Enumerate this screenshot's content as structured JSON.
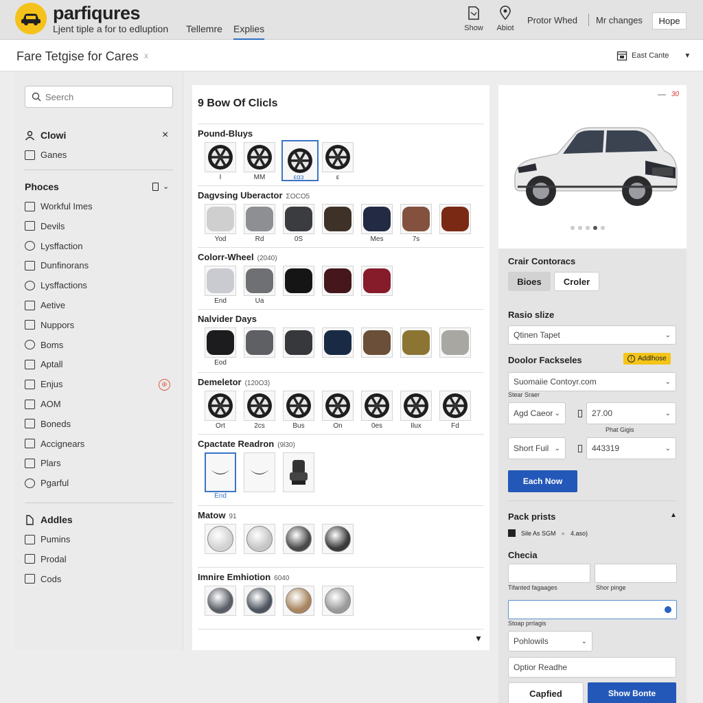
{
  "header": {
    "brand": "parfiqures",
    "tagline": "Ljent tiple a for to edluption",
    "tabs": [
      "Tellemre",
      "Explies"
    ],
    "icon_buttons": [
      {
        "icon": "document-icon",
        "label": "Show"
      },
      {
        "icon": "location-pin-icon",
        "label": "Abiot"
      }
    ],
    "links": [
      "Protor Whed",
      "Mr changes"
    ],
    "hope_label": "Hope"
  },
  "subheader": {
    "title": "Fare Tetgise for Cares",
    "close": "x",
    "sort_label": "East Cante"
  },
  "sidebar": {
    "search_placeholder": "Seerch",
    "group1": {
      "title": "Clowi",
      "close": "×",
      "items": [
        "Ganes"
      ]
    },
    "group2": {
      "title": "Phoces",
      "items": [
        "Workful Imes",
        "Devils",
        "Lysffaction",
        "Dunfinorans",
        "Lysffactions",
        "Aetive",
        "Nuppors",
        "Boms",
        "Aptall",
        "Enjus",
        "AOM",
        "Boneds",
        "Accignears",
        "Plars",
        "Pgarful"
      ]
    },
    "group3": {
      "title": "Addles",
      "items": [
        "Pumins",
        "Prodal",
        "Cods"
      ]
    }
  },
  "center": {
    "title": "9 Bow Of Clicls",
    "sections": [
      {
        "title": "Pound-Bluys",
        "hint": "",
        "kind": "wheel",
        "items": [
          {
            "label": "I"
          },
          {
            "label": "MM"
          },
          {
            "label": "εαз",
            "selected": true
          },
          {
            "label": "ε"
          }
        ]
      },
      {
        "title": "Dagvsing Uberactor",
        "hint": "ΣOCO5",
        "kind": "blob",
        "items": [
          {
            "label": "Yod",
            "color": "#cfcfcf"
          },
          {
            "label": "Rd",
            "color": "#8d8f93"
          },
          {
            "label": "0S",
            "color": "#3b3c40"
          },
          {
            "label": "",
            "color": "#3e3128"
          },
          {
            "label": "Mes",
            "color": "#222a44"
          },
          {
            "label": "7s",
            "color": "#84513e"
          },
          {
            "label": "",
            "color": "#7a2a14"
          }
        ]
      },
      {
        "title": "Colorr-Wheel",
        "hint": "(2040)",
        "kind": "blob",
        "items": [
          {
            "label": "End",
            "color": "#c9cbd0"
          },
          {
            "label": "Ua",
            "color": "#6f7073"
          },
          {
            "label": "",
            "color": "#151515"
          },
          {
            "label": "",
            "color": "#45161c"
          },
          {
            "label": "",
            "color": "#861b2a"
          }
        ]
      },
      {
        "title": "Nalvider Days",
        "hint": "",
        "kind": "blob",
        "items": [
          {
            "label": "Eod",
            "color": "#1c1c1f"
          },
          {
            "label": "",
            "color": "#5f6064"
          },
          {
            "label": "",
            "color": "#37383c"
          },
          {
            "label": "",
            "color": "#192a45"
          },
          {
            "label": "",
            "color": "#6b4f38"
          },
          {
            "label": "",
            "color": "#8c7532"
          },
          {
            "label": "",
            "color": "#a9a7a2"
          }
        ]
      },
      {
        "title": "Demeletor",
        "hint": "(120O3)",
        "kind": "wheel",
        "items": [
          {
            "label": "Ort"
          },
          {
            "label": "2cs"
          },
          {
            "label": "Bus"
          },
          {
            "label": "On"
          },
          {
            "label": "0es"
          },
          {
            "label": "Ilux"
          },
          {
            "label": "Fd"
          }
        ]
      },
      {
        "title": "Cpactate Readron",
        "hint": "(9l30)",
        "kind": "seat",
        "items": [
          {
            "label": "End",
            "selected": true
          },
          {
            "label": ""
          },
          {
            "label": ""
          }
        ]
      },
      {
        "title": "Matow",
        "hint": "91",
        "kind": "disc",
        "items": [
          {
            "color": "#d2d2d2"
          },
          {
            "color": "#c6c6c6"
          },
          {
            "color": "#4a4a4a"
          },
          {
            "color": "#3a3a3a"
          }
        ]
      },
      {
        "title": "Imnire Emhiotion",
        "hint": "6040",
        "kind": "disc",
        "items": [
          {
            "color": "#5a5e66"
          },
          {
            "color": "#4d5560"
          },
          {
            "color": "#a8855e"
          },
          {
            "color": "#9a9a9a"
          }
        ]
      }
    ]
  },
  "preview": {
    "close": "—",
    "corner": "30",
    "dots_total": 5,
    "dots_active": 4
  },
  "options": {
    "crair_title": "Crair Contoracs",
    "seg": [
      "Bioes",
      "Croler"
    ],
    "rasio_title": "Rasio slize",
    "rasio_select": "Qtinen Tapet",
    "doolor_title": "Doolor Fackseles",
    "badge": "Addlhose",
    "doolor_select": "Suomaiie Contoyr.com",
    "small1": "Stear Sraer",
    "agd_select": "Agd Caeor",
    "val1": "27.00",
    "small2": "Phat Gigis",
    "short_select": "Short Fuil",
    "val2": "443319",
    "each_btn": "Each Now",
    "pack_title": "Pack prists",
    "pack_note": "Sile As SGM",
    "pack_note2": "4.aso)",
    "checia_title": "Checia",
    "lbl_a": "Tifanted fagaages",
    "lbl_b": "Shor pinge",
    "lbl_c": "Stoap prrlagis",
    "poho_select": "Pohlowils",
    "optior_input": "Optior Readhe",
    "captied_btn": "Capfied",
    "show_btn": "Show Bonte"
  }
}
